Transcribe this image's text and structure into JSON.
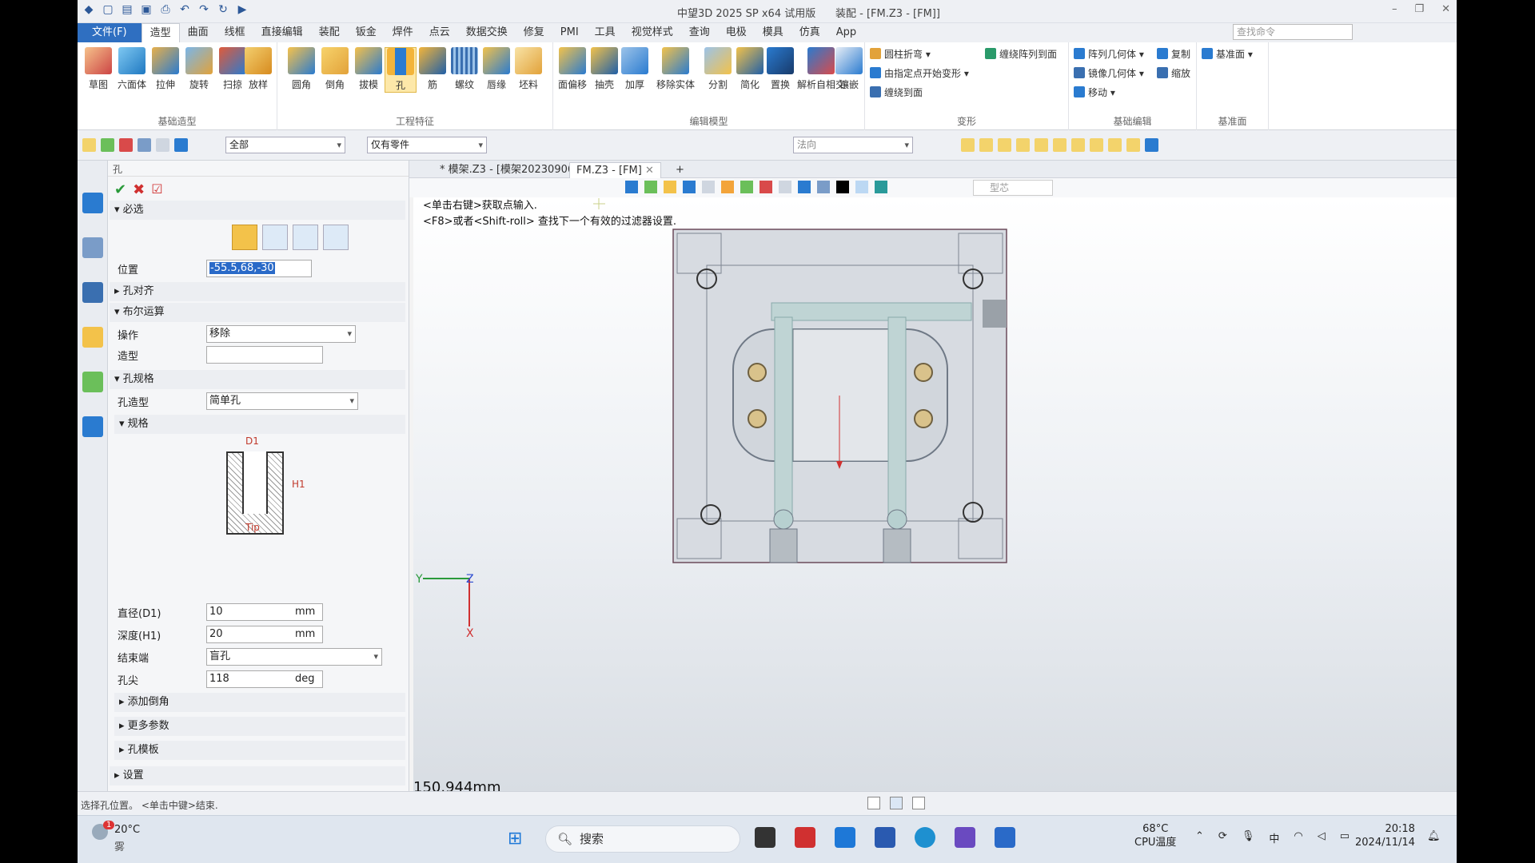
{
  "app": {
    "title": "中望3D 2025 SP x64 试用版",
    "doc_title": "装配 - [FM.Z3 - [FM]]"
  },
  "menu": [
    "文件(F)",
    "造型",
    "曲面",
    "线框",
    "直接编辑",
    "装配",
    "钣金",
    "焊件",
    "点云",
    "数据交换",
    "修复",
    "PMI",
    "工具",
    "视觉样式",
    "查询",
    "电极",
    "模具",
    "仿真",
    "App"
  ],
  "search_placeholder": "查找命令",
  "ribbon": {
    "groups": [
      "基础造型",
      "工程特征",
      "编辑模型",
      "变形",
      "基础编辑",
      "基准面"
    ],
    "basic": [
      "草图",
      "六面体",
      "拉伸",
      "旋转",
      "扫掠",
      "放样"
    ],
    "eng": [
      "圆角",
      "倒角",
      "拔模",
      "孔",
      "筋",
      "螺纹",
      "唇缘",
      "坯料"
    ],
    "edit": [
      "面偏移",
      "抽壳",
      "加厚",
      "移除实体",
      "分割",
      "简化",
      "置换",
      "解析自相交",
      "镶嵌"
    ],
    "deform": [
      "圆柱折弯",
      "由指定点开始变形",
      "缠绕到面",
      "缠绕阵列到面"
    ],
    "basicedit": [
      "阵列几何体",
      "复制",
      "镜像几何体",
      "缩放",
      "移动"
    ],
    "datum": [
      "基准面"
    ]
  },
  "toolbar2": {
    "filter": "全部",
    "parts": "仅有零件",
    "direction": "法向"
  },
  "panel": {
    "title": "孔",
    "required": "必选",
    "position_label": "位置",
    "position_value": "-55.5,68,-30",
    "align": "孔对齐",
    "boolean": "布尔运算",
    "op_label": "操作",
    "op_value": "移除",
    "shape_label": "造型",
    "spec": "孔规格",
    "hole_type_label": "孔造型",
    "hole_type_value": "简单孔",
    "sub_spec": "规格",
    "diagram": {
      "d1": "D1",
      "h1": "H1",
      "tip": "Tip"
    },
    "d1_label": "直径(D1)",
    "d1_value": "10",
    "d1_unit": "mm",
    "h1_label": "深度(H1)",
    "h1_value": "20",
    "h1_unit": "mm",
    "end_label": "结束端",
    "end_value": "盲孔",
    "tip_label": "孔尖",
    "tip_value": "118",
    "tip_unit": "deg",
    "add_chamfer": "添加倒角",
    "more": "更多参数",
    "template": "孔模板",
    "settings": "设置"
  },
  "tabs": [
    "* 模架.Z3 - [模架20230906]",
    "FM.Z3 - [FM]"
  ],
  "view_filter": "型芯",
  "hint": {
    "line1": "<单击右键>获取点输入.",
    "line2": "<F8>或者<Shift-roll> 查找下一个有效的过滤器设置."
  },
  "axes": {
    "y": "Y",
    "z": "Z",
    "x": "X"
  },
  "scale": "150.944mm",
  "status": "选择孔位置。 <单击中键>结束.",
  "taskbar": {
    "weather_temp": "20°C",
    "weather_desc": "雾",
    "weather_badge": "1",
    "search": "搜索",
    "cpu_temp": "68°C",
    "cpu_label": "CPU温度",
    "ime": "中",
    "time": "20:18",
    "date": "2024/11/14"
  }
}
